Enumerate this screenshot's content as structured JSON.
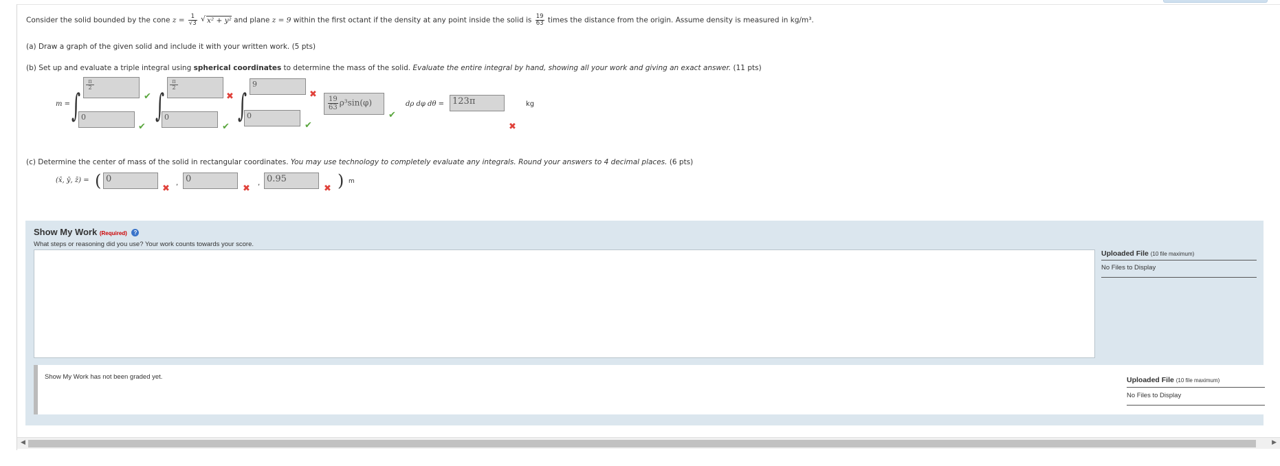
{
  "problem": {
    "intro_a": "Consider the solid bounded by the cone",
    "cone_lhs": "z =",
    "cone_frac_num": "1",
    "cone_frac_den": "√3",
    "cone_sqrt": "x² + y²",
    "intro_b": "and plane",
    "plane": "z = 9",
    "intro_c": "within the first octant if the density at any point inside the solid is",
    "density_num": "19",
    "density_den": "63",
    "intro_d": "times the distance from the origin. Assume density is measured in kg/m³.",
    "part_a": "(a) Draw a graph of the given solid and include it with your written work. (5 pts)",
    "part_b_pre": "(b) Set up and evaluate a triple integral using",
    "part_b_bold": "spherical coordinates",
    "part_b_mid": "to determine the mass of the solid.",
    "part_b_italic": "Evaluate the entire integral by hand, showing all your work and giving an exact answer.",
    "part_b_pts": "(11 pts)",
    "part_c_pre": "(c) Determine the center of mass of the solid in rectangular coordinates.",
    "part_c_italic": "You may use technology to completely evaluate any integrals. Round your answers to 4 decimal places.",
    "part_c_pts": "(6 pts)"
  },
  "mass": {
    "label": "m =",
    "outer_upper_num": "π",
    "outer_upper_den": "2",
    "outer_lower": "0",
    "middle_upper_num": "π",
    "middle_upper_den": "2",
    "middle_lower": "0",
    "inner_upper": "9",
    "inner_lower": "0",
    "integrand_num": "19",
    "integrand_den": "63",
    "integrand_rest": "ρ³sin(φ)",
    "differentials": "dρ dφ dθ =",
    "result": "123π",
    "unit": "kg"
  },
  "center": {
    "label": "(x̄, ȳ, z̄) =",
    "x": "0",
    "y": "0",
    "z": "0.95",
    "unit": "m"
  },
  "work": {
    "title": "Show My Work",
    "required": "(Required)",
    "subtitle": "What steps or reasoning did you use? Your work counts towards your score.",
    "upload_title": "Uploaded File",
    "upload_limit": "(10 file maximum)",
    "no_files": "No Files to Display",
    "graded_text": "Show My Work has not been graded yet."
  },
  "colors": {
    "correct": "#5aa63e",
    "incorrect": "#e0413a",
    "panel": "#dbe6ee"
  }
}
